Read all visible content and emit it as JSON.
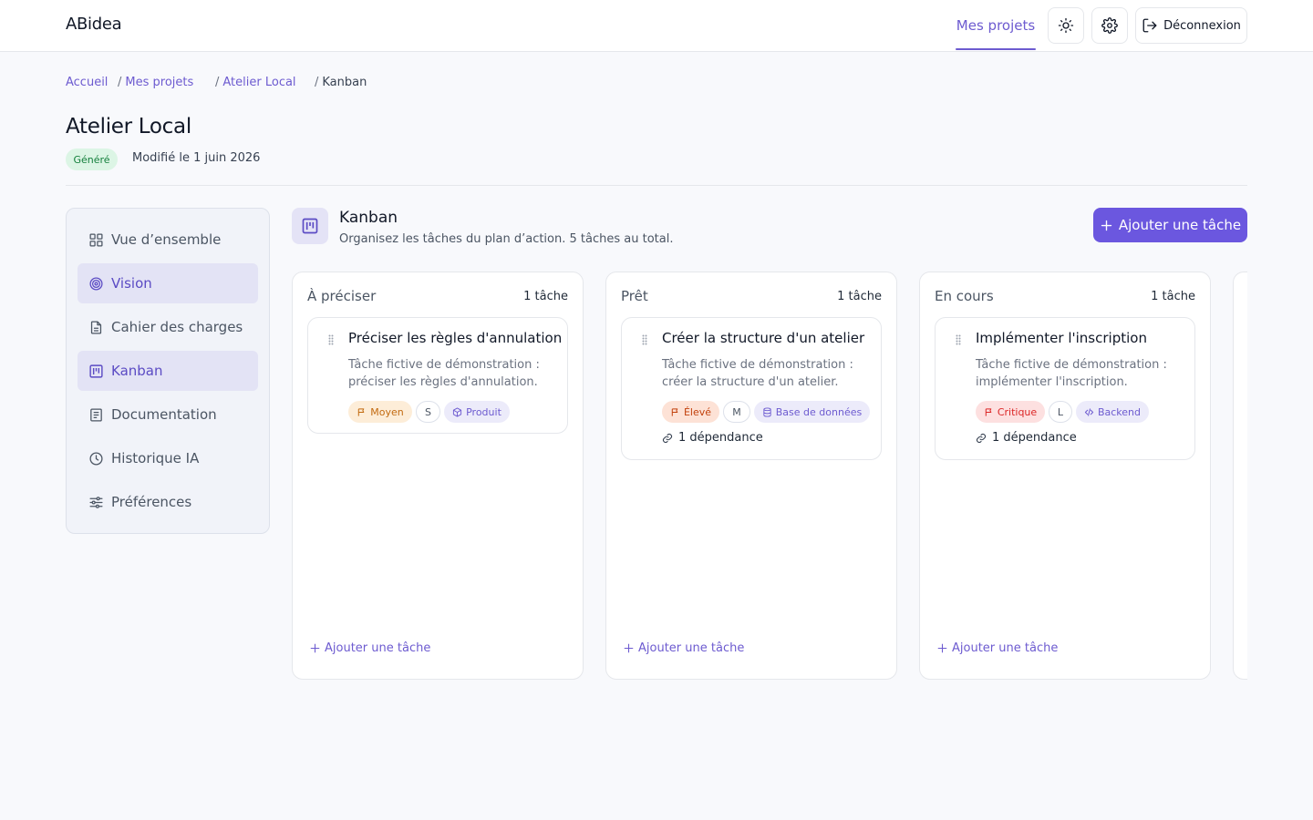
{
  "header": {
    "brand": "ABidea",
    "nav_projects": "Mes projets",
    "logout_label": "Déconnexion"
  },
  "breadcrumb": [
    {
      "label": "Accueil"
    },
    {
      "label": "Mes projets"
    },
    {
      "label": "Atelier Local"
    },
    {
      "label": "Kanban"
    }
  ],
  "project": {
    "title": "Atelier Local",
    "status_badge": "Généré",
    "modified": "Modifié le 1 juin 2026"
  },
  "sidebar": {
    "items": [
      {
        "label": "Vue d’ensemble",
        "icon": "grid-icon"
      },
      {
        "label": "Vision",
        "icon": "target-icon"
      },
      {
        "label": "Cahier des charges",
        "icon": "document-icon"
      },
      {
        "label": "Kanban",
        "icon": "kanban-icon"
      },
      {
        "label": "Documentation",
        "icon": "book-icon"
      },
      {
        "label": "Historique IA",
        "icon": "clock-icon"
      },
      {
        "label": "Préférences",
        "icon": "sliders-icon"
      }
    ]
  },
  "kanban": {
    "title": "Kanban",
    "subtitle": "Organisez les tâches du plan d’action. 5 tâches au total.",
    "add_label": "Ajouter une tâche",
    "columns": [
      {
        "name": "À préciser",
        "count": "1 tâche",
        "add_label": "Ajouter une tâche",
        "card": {
          "title": "Préciser les règles d'annulation",
          "description": "Tâche fictive de démonstration : préciser les règles d'annulation.",
          "priority": "Moyen",
          "size": "S",
          "category": "Produit",
          "dependency": ""
        }
      },
      {
        "name": "Prêt",
        "count": "1 tâche",
        "add_label": "Ajouter une tâche",
        "card": {
          "title": "Créer la structure d'un atelier",
          "description": "Tâche fictive de démonstration : créer la structure d'un atelier.",
          "priority": "Élevé",
          "size": "M",
          "category": "Base de données",
          "dependency": "1 dépendance"
        }
      },
      {
        "name": "En cours",
        "count": "1 tâche",
        "add_label": "Ajouter une tâche",
        "card": {
          "title": "Implémenter l'inscription",
          "description": "Tâche fictive de démonstration : implémenter l'inscription.",
          "priority": "Critique",
          "size": "L",
          "category": "Backend",
          "dependency": "1 dépendance"
        }
      }
    ]
  },
  "colors": {
    "accent": "#6b57df",
    "accent_text": "#6d5bd0",
    "generated_badge_bg": "#dcf5e5",
    "generated_badge_text": "#15803d"
  }
}
